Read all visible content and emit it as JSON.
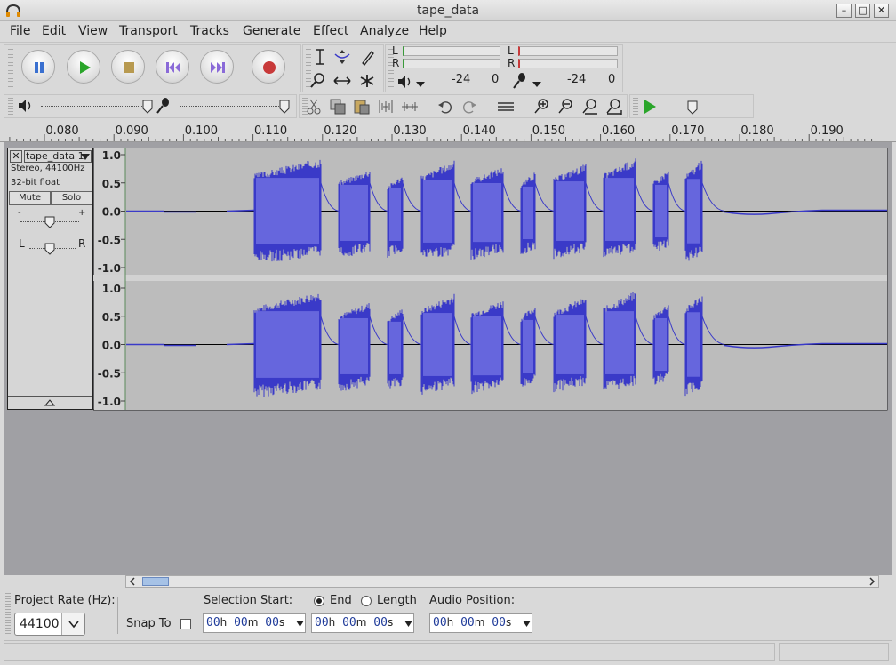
{
  "window": {
    "title": "tape_data",
    "buttons": {
      "minimize": "–",
      "maximize": "□",
      "close": "✕"
    }
  },
  "menu": [
    "File",
    "Edit",
    "View",
    "Transport",
    "Tracks",
    "Generate",
    "Effect",
    "Analyze",
    "Help"
  ],
  "meters": {
    "playback": {
      "l": "L",
      "r": "R",
      "left_value": "-24",
      "right_value": "0"
    },
    "record": {
      "l": "L",
      "r": "R",
      "left_value": "-24",
      "right_value": "0"
    }
  },
  "ruler": {
    "labels": [
      "0.080",
      "0.090",
      "0.100",
      "0.110",
      "0.120",
      "0.130",
      "0.140",
      "0.150",
      "0.160",
      "0.170",
      "0.180",
      "0.190"
    ]
  },
  "track": {
    "name": "tape_data 1",
    "info1": "Stereo, 44100Hz",
    "info2": "32-bit float",
    "mute": "Mute",
    "solo": "Solo",
    "pan_left": "L",
    "pan_right": "R",
    "gain_minus": "-",
    "gain_plus": "+",
    "y_labels": [
      "1.0",
      "0.5",
      "0.0",
      "-0.5",
      "-1.0"
    ]
  },
  "bottom": {
    "project_rate_label": "Project Rate (Hz):",
    "project_rate_value": "44100",
    "snap_label": "Snap To",
    "selection_start_label": "Selection Start:",
    "end_label": "End",
    "length_label": "Length",
    "audio_position_label": "Audio Position:",
    "time": {
      "h": "00",
      "m": "00",
      "s": "00",
      "hu": "h",
      "mu": "m",
      "su": "s"
    }
  },
  "colors": {
    "waveform": "#3a3ac8",
    "waveform_fill": "#6f6fe0",
    "track_bg": "#bcbcbc"
  }
}
